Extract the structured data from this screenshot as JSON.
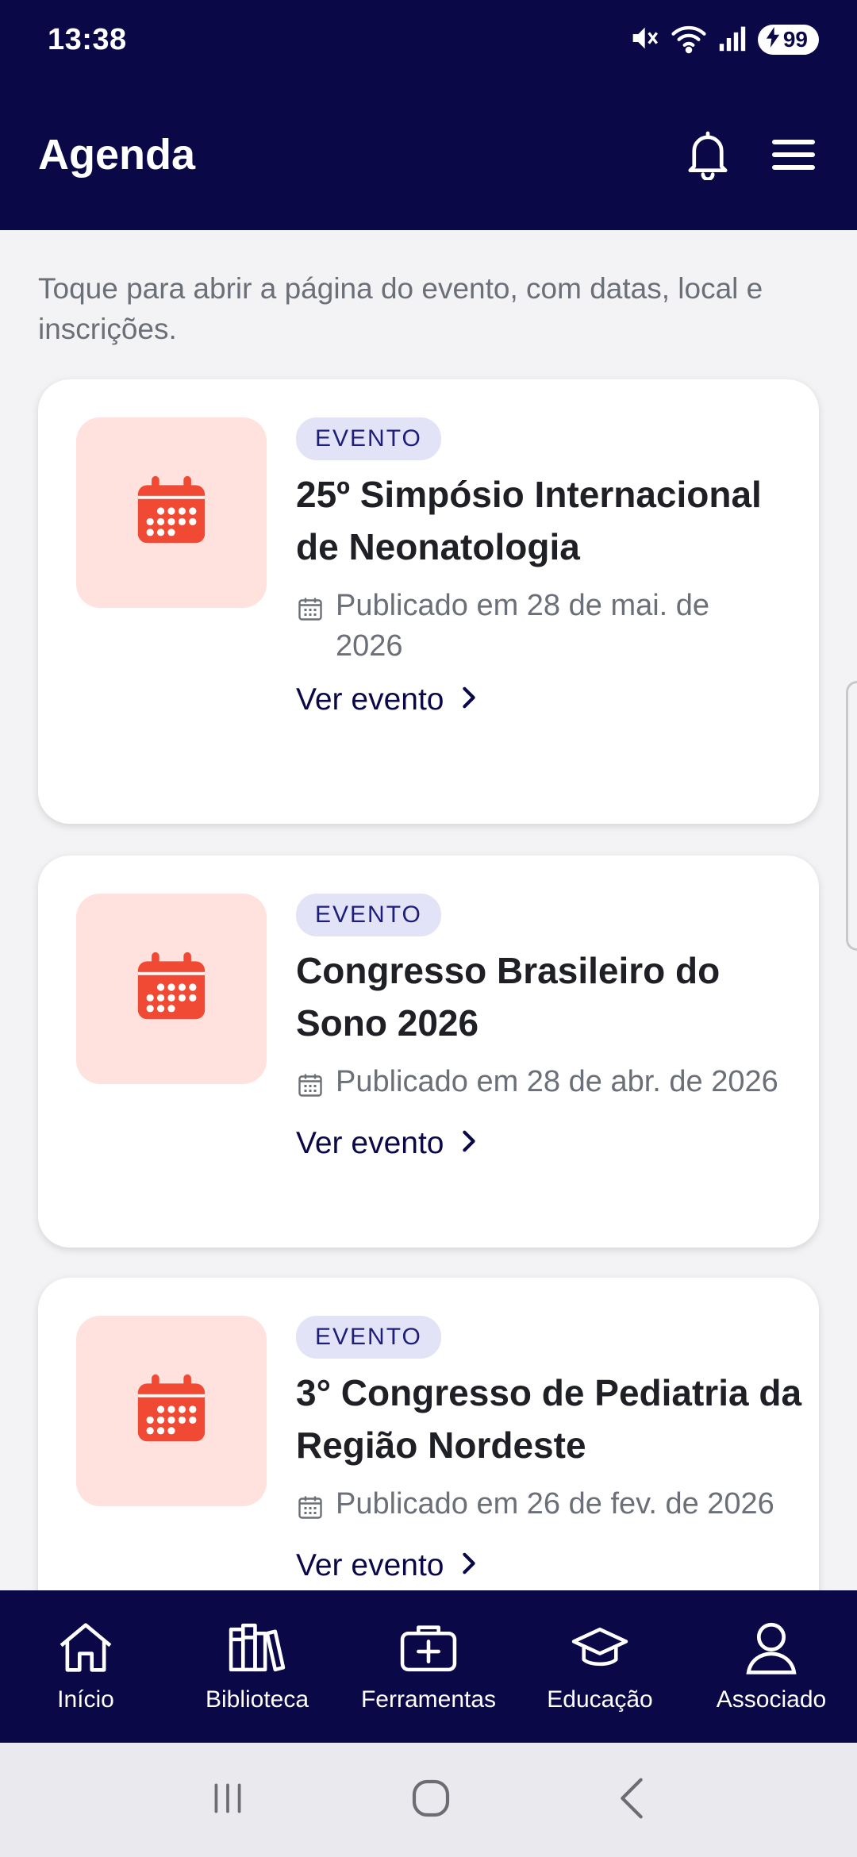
{
  "status_bar": {
    "time": "13:38",
    "battery": "99",
    "icons": [
      "mute-icon",
      "wifi-icon",
      "signal-icon",
      "battery-charging-icon"
    ]
  },
  "header": {
    "title": "Agenda",
    "icons": [
      "bell-icon",
      "menu-icon"
    ]
  },
  "hint": "Toque para abrir a página do evento, com datas, local e inscrições.",
  "events": [
    {
      "tag": "EVENTO",
      "title": "25º Simpósio Internacional de Neonatologia",
      "published": "Publicado em 28 de mai. de 2026",
      "link": "Ver evento"
    },
    {
      "tag": "EVENTO",
      "title": "Congresso Brasileiro do Sono 2026",
      "published": "Publicado em 28 de abr. de 2026",
      "link": "Ver evento"
    },
    {
      "tag": "EVENTO",
      "title": "3° Congresso de Pediatria da Região Nordeste",
      "published": "Publicado em 26 de fev. de 2026",
      "link": "Ver evento"
    }
  ],
  "bottom_nav": [
    {
      "label": "Início",
      "icon": "home-icon"
    },
    {
      "label": "Biblioteca",
      "icon": "library-icon"
    },
    {
      "label": "Ferramentas",
      "icon": "medical-kit-icon"
    },
    {
      "label": "Educação",
      "icon": "graduation-cap-icon"
    },
    {
      "label": "Associado",
      "icon": "user-icon"
    }
  ],
  "colors": {
    "primary": "#0b0848",
    "accent": "#f04a34",
    "thumb_bg": "#ffe2de",
    "tag_bg": "#e2e3f6",
    "muted_text": "#6b6f78"
  }
}
